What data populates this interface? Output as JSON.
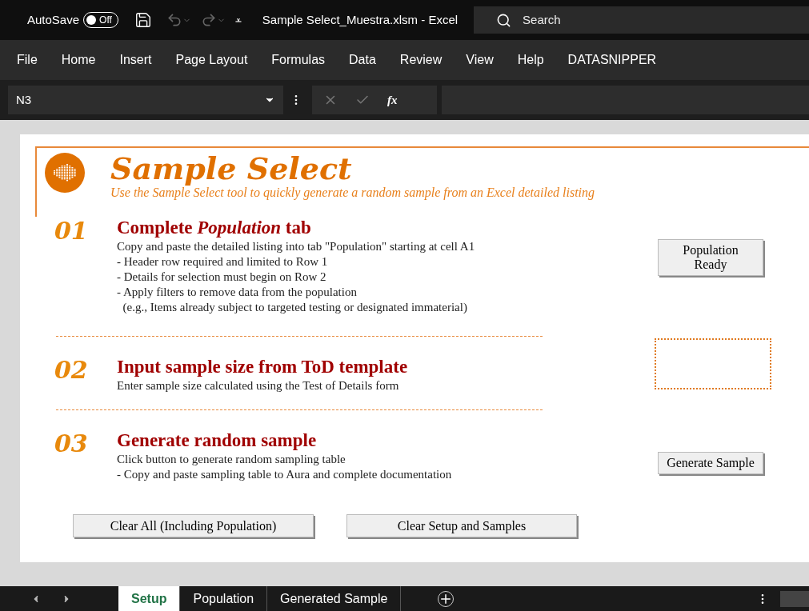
{
  "title_bar": {
    "autosave_label": "AutoSave",
    "autosave_toggle": {
      "label": "Off",
      "on": false
    },
    "quick_access_more": "⩡",
    "file_title": "Sample Select_Muestra.xlsm  -  Excel",
    "search": {
      "placeholder": "Search"
    }
  },
  "ribbon_tabs": [
    {
      "label": "File",
      "selected": false
    },
    {
      "label": "Home",
      "selected": false
    },
    {
      "label": "Insert",
      "selected": false
    },
    {
      "label": "Page Layout",
      "selected": false
    },
    {
      "label": "Formulas",
      "selected": false
    },
    {
      "label": "Data",
      "selected": false
    },
    {
      "label": "Review",
      "selected": false
    },
    {
      "label": "View",
      "selected": false
    },
    {
      "label": "Help",
      "selected": false
    },
    {
      "label": "DATASNIPPER",
      "selected": false
    }
  ],
  "formula_bar": {
    "name_box": "N3",
    "fx": "fx"
  },
  "sheet": {
    "title": "Sample Select",
    "subtitle": "Use the Sample Select tool to quickly generate a random sample from an Excel detailed listing",
    "steps": [
      {
        "number": "01",
        "title": "Complete *Population* tab",
        "lines": [
          "Copy and paste the detailed listing into tab \"Population\" starting at cell A1",
          "- Header row required and limited to Row 1",
          "- Details for selection must begin on Row 2",
          "- Apply filters to remove data from the population",
          "  (e.g., Items already subject to targeted testing or designated immaterial)"
        ],
        "control": {
          "kind": "button",
          "lines": [
            "Population",
            "Ready"
          ]
        }
      },
      {
        "number": "02",
        "title": "Input sample size from ToD template",
        "lines": [
          "Enter sample size calculated using the Test of Details form"
        ],
        "control": {
          "kind": "input"
        }
      },
      {
        "number": "03",
        "title": "Generate random sample",
        "lines": [
          "Click button to generate random sampling table",
          "- Copy and paste sampling table to Aura and complete documentation"
        ],
        "control": {
          "kind": "button",
          "lines": [
            "Generate Sample"
          ]
        }
      }
    ],
    "bottom_buttons": [
      "Clear All (Including Population)",
      "Clear Setup and Samples"
    ]
  },
  "sheet_tabs": [
    {
      "label": "Setup",
      "selected": true
    },
    {
      "label": "Population",
      "selected": false
    },
    {
      "label": "Generated Sample",
      "selected": false
    }
  ]
}
